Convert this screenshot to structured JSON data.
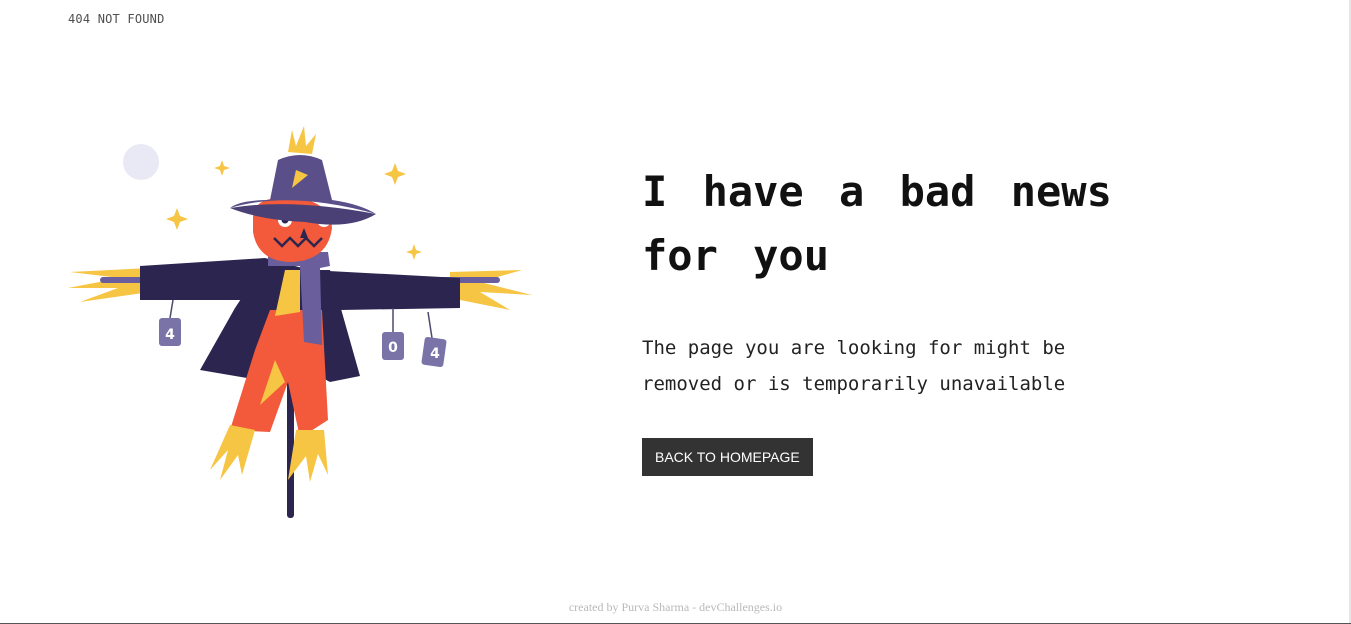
{
  "topbar": {
    "label": "404 NOT FOUND"
  },
  "illustration": {
    "icon": "scarecrow-illustration",
    "cans": [
      "4",
      "0",
      "4"
    ],
    "colors": {
      "hat": "#5b4f8a",
      "coat": "#2b2550",
      "face": "#f25a3b",
      "straw": "#f6c544",
      "scarf": "#6b5e9c",
      "moon": "#e8e9f4"
    }
  },
  "main": {
    "headline": "I have a bad news for you",
    "description": "The page you are looking for might be removed or is temporarily unavailable",
    "button_label": "BACK TO HOMEPAGE"
  },
  "footer": {
    "credit": "created by Purva Sharma - devChallenges.io"
  }
}
